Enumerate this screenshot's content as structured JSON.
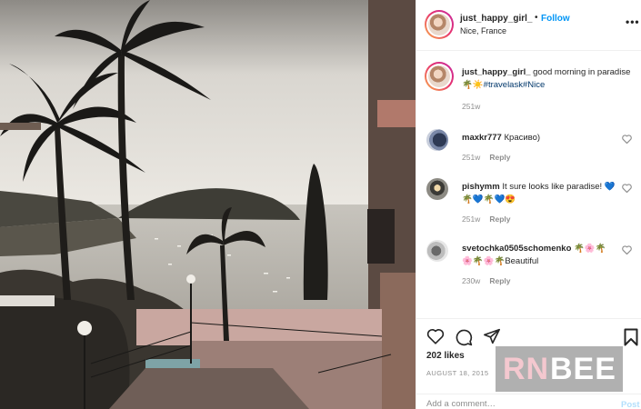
{
  "post": {
    "owner_username": "just_happy_girl_",
    "separator": "•",
    "follow_label": "Follow",
    "location": "Nice, France",
    "more_icon": "more-options-icon"
  },
  "caption": {
    "username": "just_happy_girl_",
    "text": " good morning in paradise🌴☀️",
    "hashtag1": "#travelask",
    "hashtag2": "#Nice",
    "time": "251w"
  },
  "comments": [
    {
      "username": "maxkr777",
      "text": " Красиво)",
      "time": "251w",
      "reply_label": "Reply"
    },
    {
      "username": "pishymm",
      "text": " It sure looks like paradise! 💙🌴💙🌴💙😍",
      "time": "251w",
      "reply_label": "Reply"
    },
    {
      "username": "svetochka0505schomenko",
      "text": " 🌴🌸🌴 🌸🌴🌸🌴Beautiful",
      "time": "230w",
      "reply_label": "Reply"
    }
  ],
  "actions": {
    "likes": "202 likes",
    "date": "AUGUST 18, 2015",
    "comment_placeholder": "Add a comment…",
    "post_label": "Post"
  },
  "watermark": {
    "part1": "RN",
    "part2": "BEE"
  },
  "colors": {
    "accent": "#0095f6",
    "hashtag": "#00376b",
    "muted": "#8e8e8e",
    "post_disabled": "#b2dffc"
  }
}
